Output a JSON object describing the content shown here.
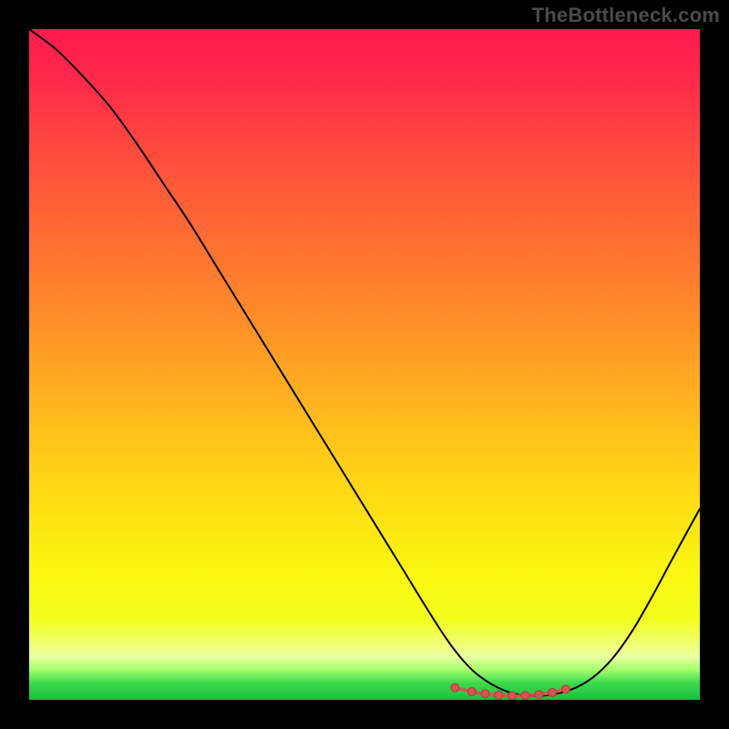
{
  "watermark": "TheBottleneck.com",
  "colors": {
    "background": "#000000",
    "text_muted": "#4a4a4a",
    "curve": "#000000",
    "marker_fill": "#d9534f",
    "marker_stroke": "#b23a36",
    "gradient_stops": [
      {
        "offset": 0.0,
        "color": "#ff1a4d"
      },
      {
        "offset": 0.08,
        "color": "#ff2a4a"
      },
      {
        "offset": 0.18,
        "color": "#ff4a3e"
      },
      {
        "offset": 0.3,
        "color": "#ff6a33"
      },
      {
        "offset": 0.42,
        "color": "#ff8a2a"
      },
      {
        "offset": 0.55,
        "color": "#ffb21f"
      },
      {
        "offset": 0.68,
        "color": "#ffd714"
      },
      {
        "offset": 0.8,
        "color": "#faf50f"
      },
      {
        "offset": 0.88,
        "color": "#f3ff1a"
      },
      {
        "offset": 0.935,
        "color": "#ecffa0"
      },
      {
        "offset": 0.955,
        "color": "#a4ff6b"
      },
      {
        "offset": 0.975,
        "color": "#3dd94d"
      },
      {
        "offset": 1.0,
        "color": "#17c23c"
      }
    ]
  },
  "chart_data": {
    "type": "line",
    "title": "",
    "xlabel": "",
    "ylabel": "",
    "xlim": [
      0,
      100
    ],
    "ylim": [
      0,
      100
    ],
    "grid": false,
    "series": [
      {
        "name": "bottleneck-curve",
        "x": [
          0,
          4,
          8,
          12,
          16,
          20,
          24,
          28,
          32,
          36,
          40,
          44,
          48,
          52,
          56,
          60,
          63,
          66,
          69,
          72,
          75,
          78,
          81,
          84,
          87,
          90,
          93,
          96,
          100
        ],
        "y": [
          100,
          97,
          93,
          88.5,
          83,
          77,
          71,
          64.5,
          58,
          51.5,
          45,
          38.5,
          32,
          25.5,
          19,
          12.5,
          8,
          4.5,
          2.3,
          1.0,
          0.6,
          0.8,
          1.6,
          3.3,
          6.2,
          10.4,
          15.6,
          21.2,
          28.5
        ]
      }
    ],
    "highlight_markers": {
      "name": "optimal-range",
      "x": [
        63.5,
        66,
        68,
        70,
        72,
        74,
        76,
        78,
        80
      ],
      "y": [
        1.8,
        1.2,
        0.9,
        0.7,
        0.6,
        0.65,
        0.8,
        1.1,
        1.6
      ]
    }
  }
}
